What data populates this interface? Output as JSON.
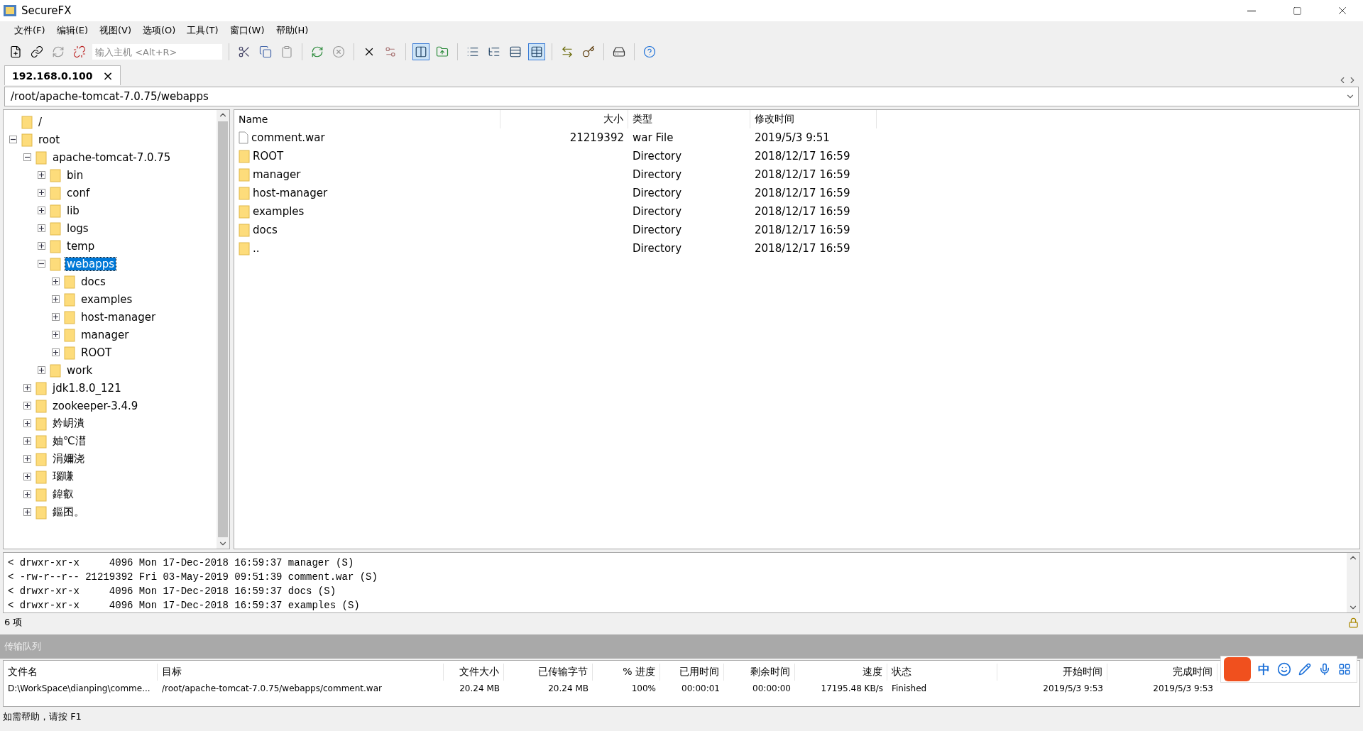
{
  "window": {
    "title": "SecureFX"
  },
  "menu": [
    "文件(F)",
    "编辑(E)",
    "视图(V)",
    "选项(O)",
    "工具(T)",
    "窗口(W)",
    "帮助(H)"
  ],
  "toolbar": {
    "host_placeholder": "输入主机 <Alt+R>",
    "tree_pane_shown": true,
    "view_modes": [
      {
        "selected": false
      },
      {
        "selected": false
      },
      {
        "selected": false
      },
      {
        "selected": true
      }
    ]
  },
  "tabs": [
    {
      "label": "192.168.0.100",
      "selected": true,
      "close": "×"
    }
  ],
  "path": "/root/apache-tomcat-7.0.75/webapps",
  "tree": [
    {
      "label": "/",
      "selected": false
    },
    {
      "label": "root",
      "expanded": true,
      "selected": false,
      "children": [
        {
          "label": "apache-tomcat-7.0.75",
          "expanded": true,
          "selected": false,
          "children": [
            {
              "label": "bin",
              "expanded": false,
              "selected": false
            },
            {
              "label": "conf",
              "expanded": false,
              "selected": false
            },
            {
              "label": "lib",
              "expanded": false,
              "selected": false
            },
            {
              "label": "logs",
              "expanded": false,
              "selected": false
            },
            {
              "label": "temp",
              "expanded": false,
              "selected": false
            },
            {
              "label": "webapps",
              "expanded": true,
              "selected": true,
              "children": [
                {
                  "label": "docs",
                  "expanded": false,
                  "selected": false
                },
                {
                  "label": "examples",
                  "expanded": false,
                  "selected": false
                },
                {
                  "label": "host-manager",
                  "expanded": false,
                  "selected": false
                },
                {
                  "label": "manager",
                  "expanded": false,
                  "selected": false
                },
                {
                  "label": "ROOT",
                  "expanded": false,
                  "selected": false
                }
              ]
            },
            {
              "label": "work",
              "expanded": false,
              "selected": false
            }
          ]
        },
        {
          "label": "jdk1.8.0_121",
          "expanded": false,
          "selected": false
        },
        {
          "label": "zookeeper-3.4.9",
          "expanded": false,
          "selected": false
        },
        {
          "label": "妗岄潰",
          "expanded": false,
          "selected": false
        },
        {
          "label": "妯℃澘",
          "expanded": false,
          "selected": false
        },
        {
          "label": "涓嬭浇",
          "expanded": false,
          "selected": false
        },
        {
          "label": "瑙嗛",
          "expanded": false,
          "selected": false
        },
        {
          "label": "鍏叡",
          "expanded": false,
          "selected": false
        },
        {
          "label": "鏂囨。",
          "expanded": false,
          "selected": false
        }
      ]
    }
  ],
  "files": {
    "columns": [
      "Name",
      "大小",
      "类型",
      "修改时间"
    ],
    "rows": [
      {
        "kind": "file",
        "name": "comment.war",
        "size": "21219392",
        "type": "war File",
        "modified": "2019/5/3 9:51"
      },
      {
        "kind": "folder",
        "name": "ROOT",
        "type": "Directory",
        "modified": "2018/12/17 16:59"
      },
      {
        "kind": "folder",
        "name": "manager",
        "type": "Directory",
        "modified": "2018/12/17 16:59"
      },
      {
        "kind": "folder",
        "name": "host-manager",
        "type": "Directory",
        "modified": "2018/12/17 16:59"
      },
      {
        "kind": "folder",
        "name": "examples",
        "type": "Directory",
        "modified": "2018/12/17 16:59"
      },
      {
        "kind": "folder",
        "name": "docs",
        "type": "Directory",
        "modified": "2018/12/17 16:59"
      },
      {
        "kind": "folder",
        "name": "..",
        "type": "Directory",
        "modified": "2018/12/17 16:59"
      }
    ]
  },
  "log": [
    "< drwxr-xr-x     4096 Mon 17-Dec-2018 16:59:37 manager (S)",
    "< -rw-r--r-- 21219392 Fri 03-May-2019 09:51:39 comment.war (S)",
    "< drwxr-xr-x     4096 Mon 17-Dec-2018 16:59:37 docs (S)",
    "< drwxr-xr-x     4096 Mon 17-Dec-2018 16:59:37 examples (S)"
  ],
  "item_count": "6 项",
  "transfer_queue": {
    "title": "传输队列",
    "columns": [
      "文件名",
      "目标",
      "文件大小",
      "已传输字节",
      "% 进度",
      "已用时间",
      "剩余时间",
      "速度",
      "状态",
      "开始时间",
      "完成时间"
    ],
    "rows": [
      [
        "D:\\WorkSpace\\dianping\\comme...",
        "/root/apache-tomcat-7.0.75/webapps/comment.war",
        "20.24 MB",
        "20.24 MB",
        "100%",
        "00:00:01",
        "00:00:00",
        "17195.48 KB/s",
        "Finished",
        "2019/5/3 9:53",
        "2019/5/3 9:53"
      ]
    ]
  },
  "ime_bar": {
    "mode": "中"
  },
  "status_bar": "如需帮助，请按 F1"
}
